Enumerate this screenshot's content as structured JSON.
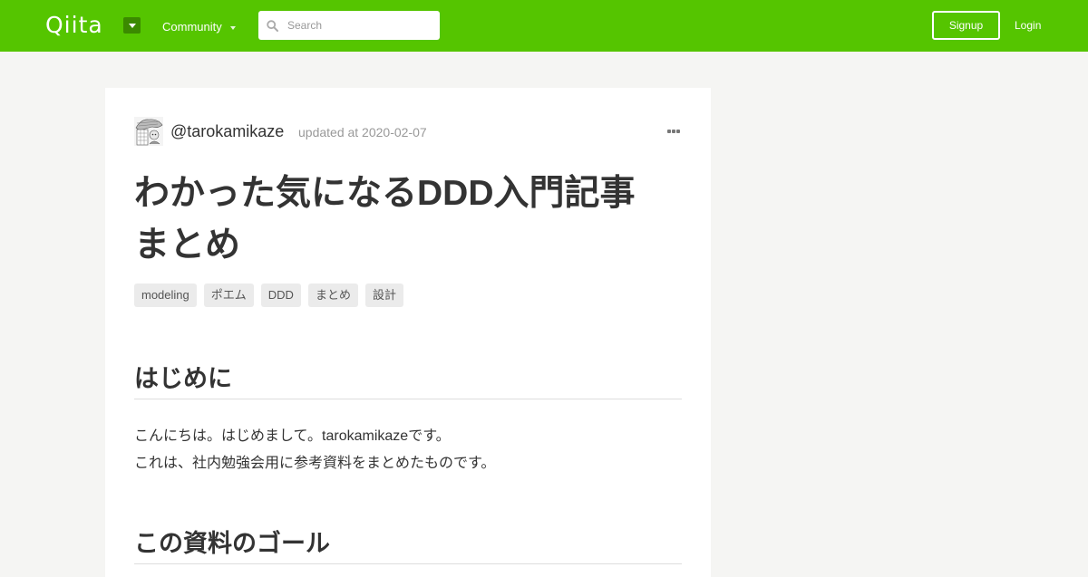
{
  "header": {
    "logo_text": "Qiita",
    "logo_menu_icon": "caret-down-icon",
    "community_label": "Community",
    "search_placeholder": "Search",
    "signup_label": "Signup",
    "login_label": "Login",
    "brand_color": "#55c500"
  },
  "article": {
    "author": "@tarokamikaze",
    "updated": "updated at 2020-02-07",
    "title_line1": "わかった気になるDDD入門記事",
    "title_line2": "まとめ",
    "tags": [
      "modeling",
      "ポエム",
      "DDD",
      "まとめ",
      "設計"
    ],
    "section1_heading": "はじめに",
    "paragraph_lines": [
      "こんにちは。はじめまして。tarokamikazeです。",
      "これは、社内勉強会用に参考資料をまとめたものです。"
    ],
    "section2_heading": "この資料のゴール"
  }
}
